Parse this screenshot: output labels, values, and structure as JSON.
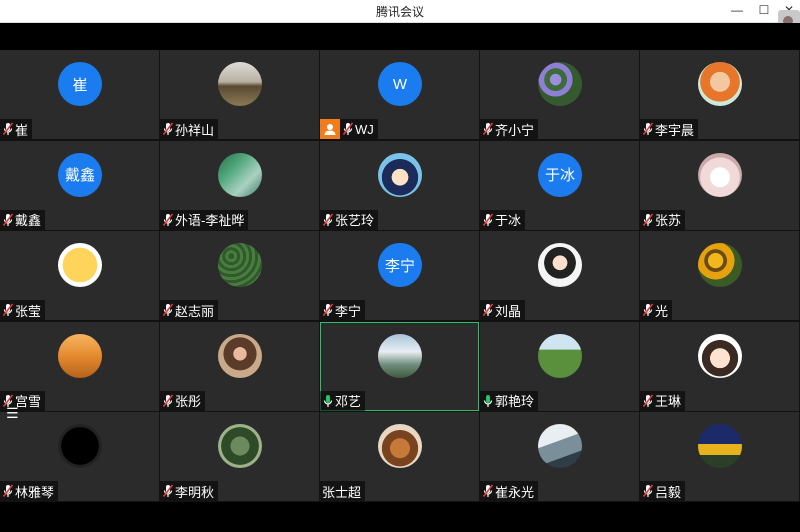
{
  "window": {
    "title": "腾讯会议"
  },
  "participants": [
    {
      "name": "崔",
      "avatar_text": "崔",
      "avatar_type": "text"
    },
    {
      "name": "孙祥山",
      "avatar_type": "photo",
      "photo": "landscape-field"
    },
    {
      "name": "WJ",
      "avatar_text": "W",
      "avatar_type": "text",
      "host": true
    },
    {
      "name": "齐小宁",
      "avatar_type": "photo",
      "photo": "purple-flowers"
    },
    {
      "name": "李宇晨",
      "avatar_type": "photo",
      "photo": "cartoon-character"
    },
    {
      "name": "戴鑫",
      "avatar_text": "戴鑫",
      "avatar_type": "text"
    },
    {
      "name": "外语-李祉晔",
      "avatar_type": "photo",
      "photo": "green-hills"
    },
    {
      "name": "张艺玲",
      "avatar_type": "photo",
      "photo": "anime-detective"
    },
    {
      "name": "于冰",
      "avatar_text": "于冰",
      "avatar_type": "text"
    },
    {
      "name": "张苏",
      "avatar_type": "photo",
      "photo": "cute-cake"
    },
    {
      "name": "张莹",
      "avatar_type": "photo",
      "photo": "smiley-emoji"
    },
    {
      "name": "赵志丽",
      "avatar_type": "photo",
      "photo": "green-texture"
    },
    {
      "name": "李宁",
      "avatar_text": "李宁",
      "avatar_type": "text"
    },
    {
      "name": "刘晶",
      "avatar_type": "photo",
      "photo": "cartoon-girl"
    },
    {
      "name": "光",
      "avatar_type": "photo",
      "photo": "sunflowers"
    },
    {
      "name": "宫雪",
      "avatar_type": "photo",
      "photo": "sunset-figure"
    },
    {
      "name": "张彤",
      "avatar_type": "photo",
      "photo": "person-portrait"
    },
    {
      "name": "邓艺",
      "avatar_type": "photo",
      "photo": "clouds-sky",
      "active": true,
      "speaking": true
    },
    {
      "name": "郭艳玲",
      "avatar_type": "photo",
      "photo": "green-field",
      "speaking": true
    },
    {
      "name": "王琳",
      "avatar_type": "photo",
      "photo": "cartoon-face"
    },
    {
      "name": "林雅琴",
      "avatar_type": "photo",
      "photo": "dark-circle"
    },
    {
      "name": "李明秋",
      "avatar_type": "photo",
      "photo": "green-leaves"
    },
    {
      "name": "张士超",
      "avatar_type": "photo",
      "photo": "food-bowl",
      "no_mic": true
    },
    {
      "name": "崔永光",
      "avatar_type": "photo",
      "photo": "mountain-snow"
    },
    {
      "name": "吕毅",
      "avatar_type": "photo",
      "photo": "night-scene"
    }
  ],
  "colors": {
    "avatar_blue": "#1b7cf0",
    "host_orange": "#f07d1a",
    "speaking_green": "#25c266",
    "muted_red": "#e03a3a"
  }
}
